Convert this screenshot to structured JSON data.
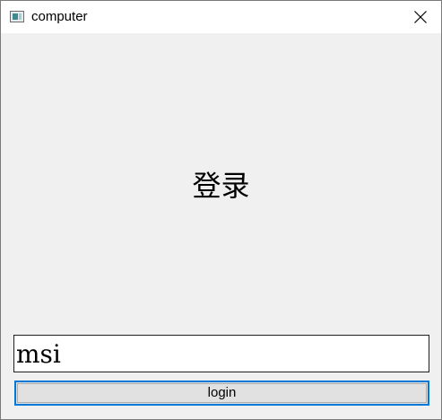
{
  "window": {
    "title": "computer",
    "icon": "app-window-icon",
    "close_icon": "close-icon"
  },
  "main": {
    "heading": "登录",
    "username_value": "msi",
    "login_label": "login"
  },
  "colors": {
    "titlebar": "#ffffff",
    "client_background": "#f0f0f0",
    "button_focus_border": "#0078d7",
    "button_background": "#e1e1e1"
  }
}
